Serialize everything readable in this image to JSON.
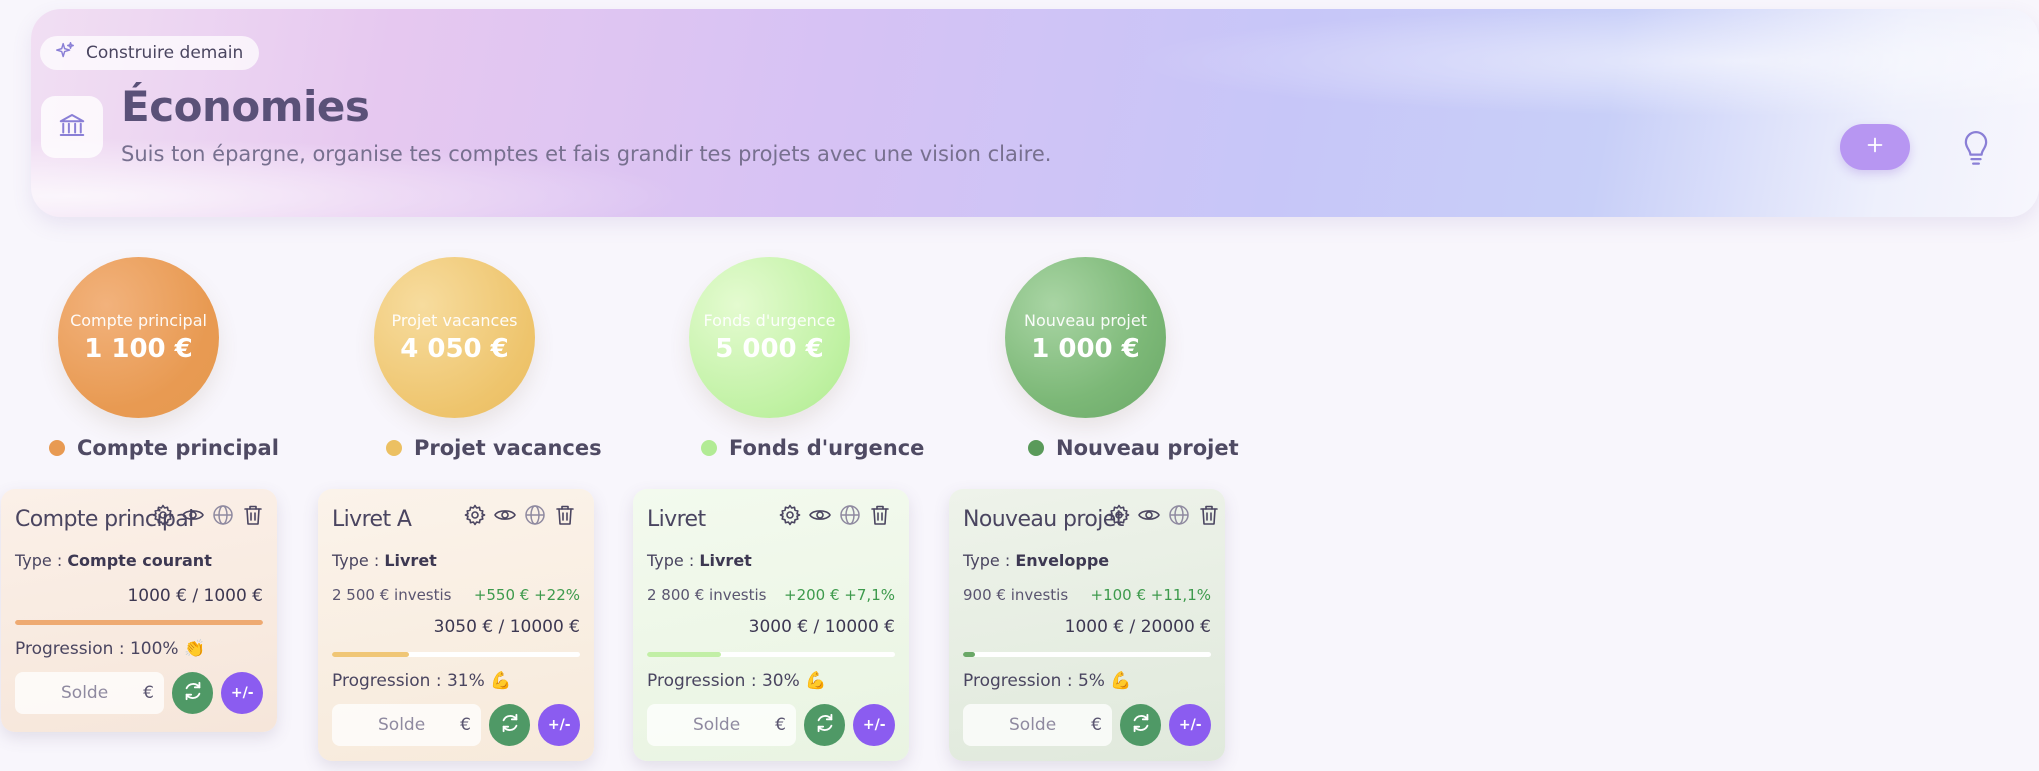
{
  "header": {
    "chip_label": "Construire demain",
    "title": "Économies",
    "subtitle": "Suis ton épargne, organise tes comptes et fais grandir tes projets avec une vision claire.",
    "add_button_label": "+",
    "icons": {
      "chip": "sparkles-icon",
      "bank": "bank-icon",
      "add": "plus-icon",
      "tip": "lightbulb-icon"
    }
  },
  "circles": [
    {
      "label": "Compte principal",
      "value": "1 100 €",
      "legend": "Compte principal",
      "color": "#e89a52"
    },
    {
      "label": "Projet vacances",
      "value": "4 050 €",
      "legend": "Projet vacances",
      "color": "#ecc062"
    },
    {
      "label": "Fonds d'urgence",
      "value": "5 000 €",
      "legend": "Fonds d'urgence",
      "color": "#b2eb95"
    },
    {
      "label": "Nouveau projet",
      "value": "1 000 €",
      "legend": "Nouveau projet",
      "color": "#5a9a5a"
    }
  ],
  "cards": [
    {
      "title": "Compte principal",
      "type_prefix": "Type : ",
      "type": "Compte courant",
      "invested": "",
      "gain": "",
      "amount": "1000 € / 1000 €",
      "progress_label": "Progression : ",
      "progress": "100%",
      "progress_emoji": "👏",
      "progress_fraction": 1.0,
      "bar_color": "#eeaa72",
      "solde_placeholder": "Solde",
      "currency": "€",
      "pm_label": "+/-"
    },
    {
      "title": "Livret A",
      "type_prefix": "Type : ",
      "type": "Livret",
      "invested": "2 500 € investis",
      "gain": "+550 € +22%",
      "amount": "3050 € / 10000 €",
      "progress_label": "Progression : ",
      "progress": "31%",
      "progress_emoji": "💪",
      "progress_fraction": 0.31,
      "bar_color": "#f0c676",
      "solde_placeholder": "Solde",
      "currency": "€",
      "pm_label": "+/-"
    },
    {
      "title": "Livret",
      "type_prefix": "Type : ",
      "type": "Livret",
      "invested": "2 800 € investis",
      "gain": "+200 € +7,1%",
      "amount": "3000 € / 10000 €",
      "progress_label": "Progression : ",
      "progress": "30%",
      "progress_emoji": "💪",
      "progress_fraction": 0.3,
      "bar_color": "#c2efa6",
      "solde_placeholder": "Solde",
      "currency": "€",
      "pm_label": "+/-"
    },
    {
      "title": "Nouveau projet",
      "type_prefix": "Type : ",
      "type": "Enveloppe",
      "invested": "900 € investis",
      "gain": "+100 € +11,1%",
      "amount": "1000 € / 20000 €",
      "progress_label": "Progression : ",
      "progress": "5%",
      "progress_emoji": "💪",
      "progress_fraction": 0.05,
      "bar_color": "#6aa867",
      "solde_placeholder": "Solde",
      "currency": "€",
      "pm_label": "+/-"
    }
  ]
}
